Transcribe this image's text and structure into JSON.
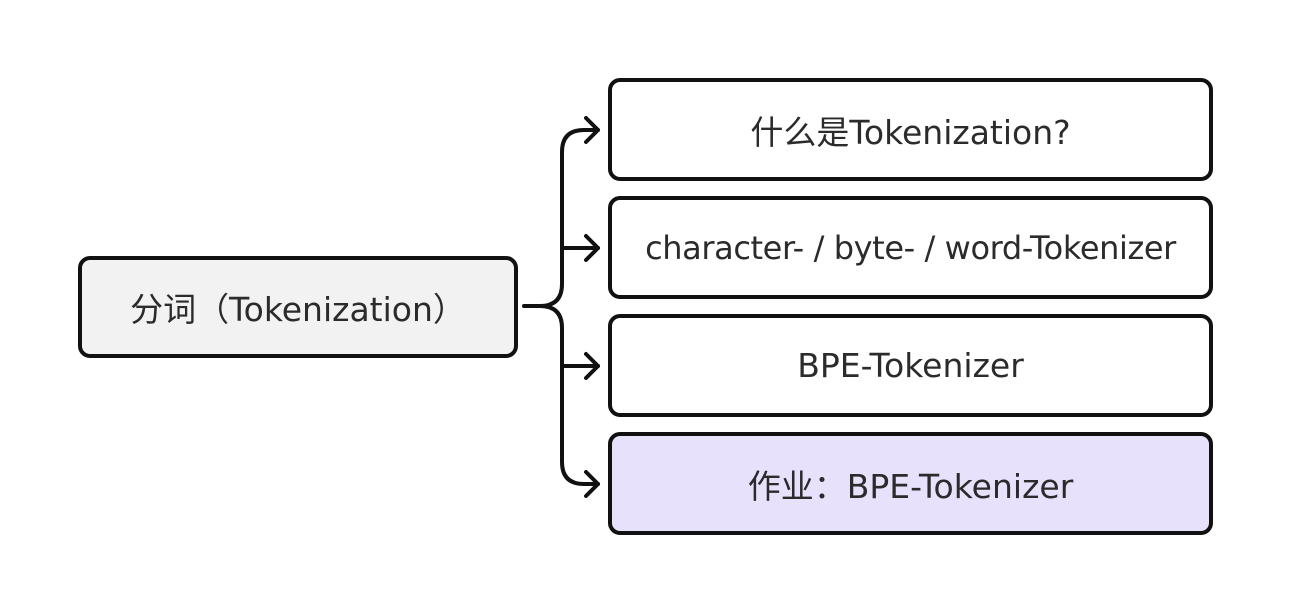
{
  "diagram": {
    "type": "mind-map",
    "root": {
      "label": "分词（Tokenization）",
      "fill": "#f2f2f2"
    },
    "children": [
      {
        "label": "什么是Tokenization?",
        "fill": "#ffffff"
      },
      {
        "label": "character- / byte- / word-Tokenizer",
        "fill": "#ffffff"
      },
      {
        "label": "BPE-Tokenizer",
        "fill": "#ffffff"
      },
      {
        "label": "作业：BPE-Tokenizer",
        "fill": "#e8e1fc"
      }
    ],
    "colors": {
      "border": "#111111",
      "text": "#2b2b2b",
      "connector": "#111111"
    }
  }
}
